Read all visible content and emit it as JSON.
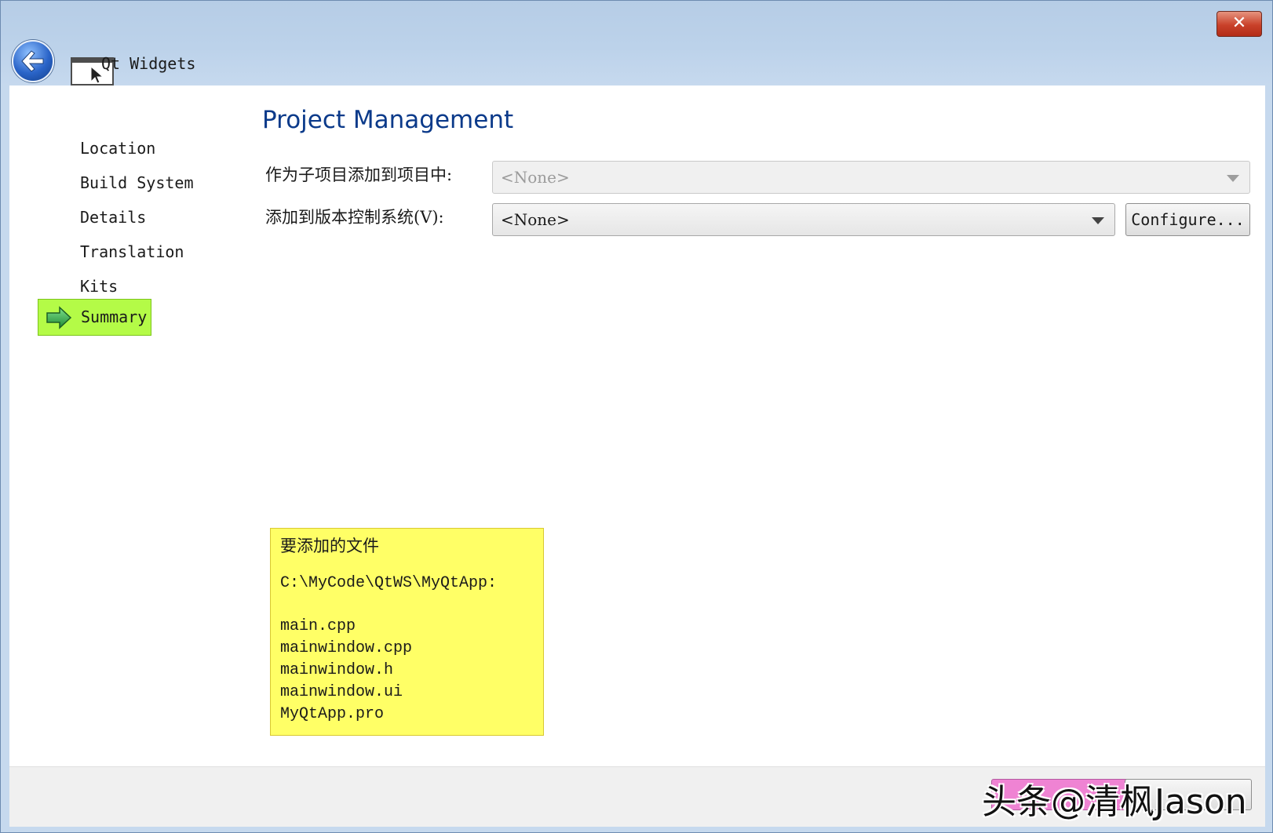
{
  "window": {
    "title": "Qt Widgets",
    "close_symbol": "✕",
    "icons": {
      "back": "back-arrow-icon",
      "wizard": "qt-widgets-window-icon",
      "step_active": "arrow-right-icon"
    }
  },
  "steps": [
    {
      "label": "Location",
      "active": false
    },
    {
      "label": "Build System",
      "active": false
    },
    {
      "label": "Details",
      "active": false
    },
    {
      "label": "Translation",
      "active": false
    },
    {
      "label": "Kits",
      "active": false
    },
    {
      "label": "Summary",
      "active": true
    }
  ],
  "page": {
    "title": "Project Management",
    "subproject": {
      "label": "作为子项目添加到项目中:",
      "value": "<None>",
      "enabled": false
    },
    "vcs": {
      "label": "添加到版本控制系统(V):",
      "value": "<None>",
      "enabled": true
    },
    "configure_label": "Configure..."
  },
  "files": {
    "heading": "要添加的文件",
    "path": "C:\\MyCode\\QtWS\\MyQtApp:",
    "list": [
      "main.cpp",
      "mainwindow.cpp",
      "mainwindow.h",
      "mainwindow.ui",
      "MyQtApp.pro"
    ]
  },
  "watermark": "头条@清枫Jason",
  "colors": {
    "active_step": "#b4fb47",
    "files_box": "#ffff66",
    "title": "#0b3a8a",
    "close_button": "#c9412a"
  }
}
